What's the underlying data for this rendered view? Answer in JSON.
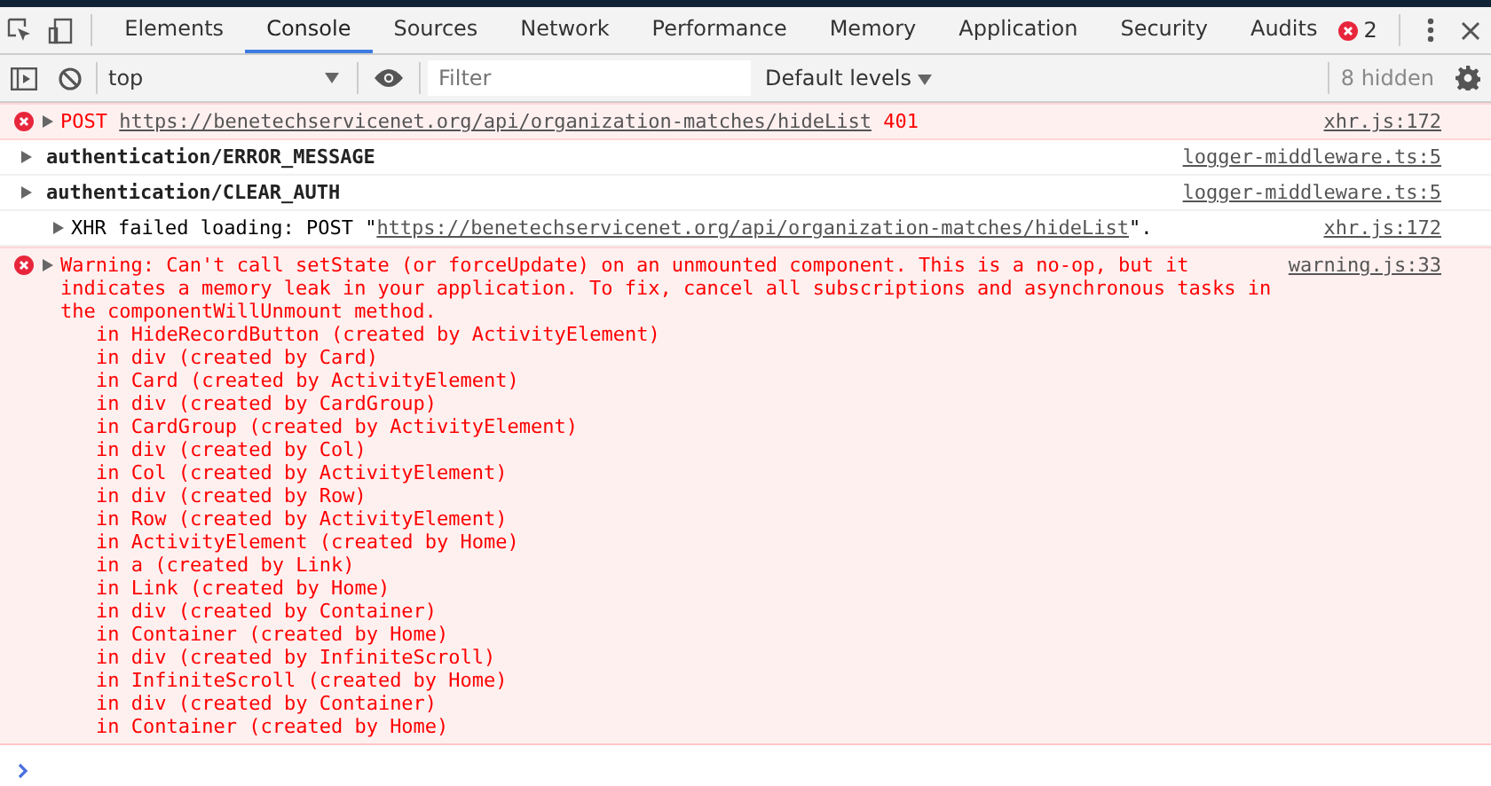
{
  "tabs": [
    {
      "label": "Elements",
      "selected": false
    },
    {
      "label": "Console",
      "selected": true
    },
    {
      "label": "Sources",
      "selected": false
    },
    {
      "label": "Network",
      "selected": false
    },
    {
      "label": "Performance",
      "selected": false
    },
    {
      "label": "Memory",
      "selected": false
    },
    {
      "label": "Application",
      "selected": false
    },
    {
      "label": "Security",
      "selected": false
    },
    {
      "label": "Audits",
      "selected": false
    }
  ],
  "error_count": "2",
  "toolbar": {
    "context": "top",
    "filter": {
      "placeholder": "Filter"
    },
    "levels": "Default levels",
    "hidden": "8 hidden"
  },
  "messages": [
    {
      "kind": "request",
      "method": "POST",
      "url": "https://benetechservicenet.org/api/organization-matches/hideList",
      "status": "401",
      "source": "xhr.js:172"
    },
    {
      "kind": "log",
      "text": "authentication/ERROR_MESSAGE",
      "source": "logger-middleware.ts:5"
    },
    {
      "kind": "log",
      "text": "authentication/CLEAR_AUTH",
      "source": "logger-middleware.ts:5"
    },
    {
      "kind": "xhr",
      "prefix": "XHR failed loading: POST \"",
      "url": "https://benetechservicenet.org/api/organization-matches/hideList",
      "suffix": "\".",
      "source": "xhr.js:172"
    },
    {
      "kind": "warning",
      "text": "Warning: Can't call setState (or forceUpdate) on an unmounted component. This is a no-op, but it indicates a memory leak in your application. To fix, cancel all subscriptions and asynchronous tasks in the componentWillUnmount method.",
      "source": "warning.js:33",
      "stack": [
        "in HideRecordButton (created by ActivityElement)",
        "in div (created by Card)",
        "in Card (created by ActivityElement)",
        "in div (created by CardGroup)",
        "in CardGroup (created by ActivityElement)",
        "in div (created by Col)",
        "in Col (created by ActivityElement)",
        "in div (created by Row)",
        "in Row (created by ActivityElement)",
        "in ActivityElement (created by Home)",
        "in a (created by Link)",
        "in Link (created by Home)",
        "in div (created by Container)",
        "in Container (created by Home)",
        "in div (created by InfiniteScroll)",
        "in InfiniteScroll (created by Home)",
        "in div (created by Container)",
        "in Container (created by Home)"
      ]
    }
  ]
}
